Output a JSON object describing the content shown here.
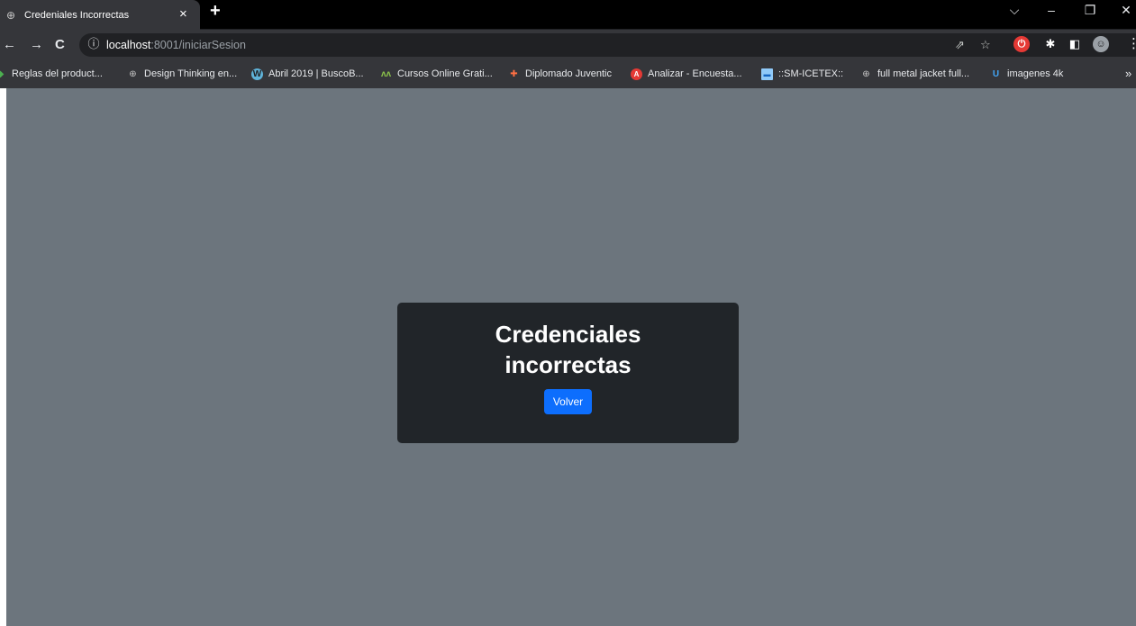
{
  "browser": {
    "tab": {
      "title": "Credeniales Incorrectas",
      "close_glyph": "×",
      "favicon": "globe-icon"
    },
    "new_tab_glyph": "+",
    "window_controls": {
      "dropdown": "⌵",
      "minimize": "–",
      "restore": "❐",
      "close": "✕"
    },
    "toolbar": {
      "back": "←",
      "forward": "→",
      "reload": "C",
      "info_glyph": "ⓘ",
      "url_host": "localhost",
      "url_rest": ":8001/iniciarSesion",
      "share_glyph": "⇗",
      "star_glyph": "☆"
    },
    "extensions": {
      "ext1": "⏻",
      "puzzle": "✱",
      "sidepanel": "◧",
      "avatar": "☺",
      "menu": "⋮"
    },
    "bookmarks": [
      {
        "label": "Reglas del product...",
        "icon": "leaf-icon",
        "glyph": "◆",
        "color": "#4caf50"
      },
      {
        "label": "Design Thinking en...",
        "icon": "globe-icon",
        "glyph": "⊕",
        "color": "#c7c7c7"
      },
      {
        "label": "Abril 2019 | BuscoB...",
        "icon": "wordpress-icon",
        "glyph": "W",
        "color": "#5fb3d9"
      },
      {
        "label": "Cursos Online Grati...",
        "icon": "edx-icon",
        "glyph": "ʌʌ",
        "color": "#8bc34a"
      },
      {
        "label": "Diplomado Juventic",
        "icon": "plus-icon",
        "glyph": "✚",
        "color": "#ff7043"
      },
      {
        "label": "Analizar - Encuesta...",
        "icon": "survey-icon",
        "glyph": "A",
        "color": "#e53935"
      },
      {
        "label": "::SM-ICETEX::",
        "icon": "icetex-icon",
        "glyph": "▬",
        "color": "#90caf9"
      },
      {
        "label": "full metal jacket full...",
        "icon": "globe-icon",
        "glyph": "⊕",
        "color": "#c7c7c7"
      },
      {
        "label": "imagenes 4k",
        "icon": "u-icon",
        "glyph": "U",
        "color": "#42a5f5"
      }
    ],
    "bookmarks_overflow": "»"
  },
  "page": {
    "title": "Credenciales incorrectas",
    "button_label": "Volver"
  },
  "colors": {
    "page_background": "#6c757d",
    "card_background": "#212529",
    "button_primary": "#0d6efd"
  }
}
